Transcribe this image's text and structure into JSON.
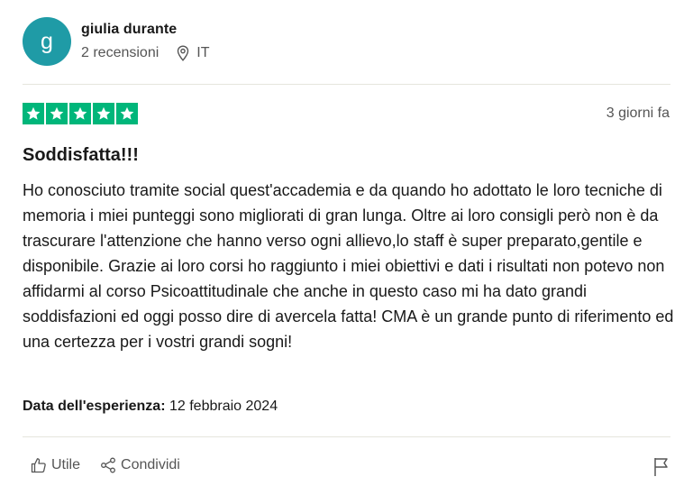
{
  "reviewer": {
    "initial": "g",
    "name": "giulia durante",
    "reviews_count": "2 recensioni",
    "country": "IT",
    "avatar_color": "#1f9ba6"
  },
  "rating": {
    "stars": 5,
    "max_stars": 5,
    "star_color": "#00b67a",
    "posted": "3 giorni fa"
  },
  "review": {
    "title": "Soddisfatta!!!",
    "text": "Ho conosciuto tramite social quest'accademia e da quando ho adottato le loro tecniche di memoria i miei punteggi sono migliorati di gran lunga. Oltre ai loro consigli però non è da trascurare l'attenzione che hanno verso ogni allievo,lo staff è super preparato,gentile e disponibile. Grazie ai loro corsi ho raggiunto i miei obiettivi e dati i risultati non potevo non affidarmi al corso Psicoattitudinale che anche in questo caso mi ha dato grandi soddisfazioni ed oggi posso dire di avercela fatta! CMA è un grande punto di riferimento ed una certezza per i vostri grandi sogni!",
    "experience_label": "Data dell'esperienza:",
    "experience_date": "12 febbraio 2024"
  },
  "actions": {
    "useful_label": "Utile",
    "share_label": "Condividi",
    "useful_icon": "thumbs-up-icon",
    "share_icon": "share-icon",
    "report_icon": "flag-icon"
  }
}
